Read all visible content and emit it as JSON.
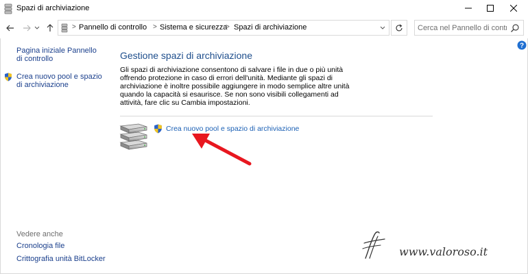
{
  "window": {
    "title": "Spazi di archiviazione"
  },
  "address_bar": {
    "crumbs": [
      "Pannello di controllo",
      "Sistema e sicurezza",
      "Spazi di archiviazione"
    ],
    "separator": ">"
  },
  "search": {
    "placeholder": "Cerca nel Pannello di controllo"
  },
  "left_pane": {
    "home_link": "Pagina iniziale Pannello di controllo",
    "create_link": "Crea nuovo pool e spazio di archiviazione",
    "see_also_header": "Vedere anche",
    "see_also": [
      "Cronologia file",
      "Crittografia unità BitLocker"
    ]
  },
  "main": {
    "title": "Gestione spazi di archiviazione",
    "description": "Gli spazi di archiviazione consentono di salvare i file in due o più unità offrendo protezione in caso di errori dell'unità. Mediante gli spazi di archiviazione è inoltre possibile aggiungere in modo semplice altre unità quando la capacità si esaurisce. Se non sono visibili collegamenti ad attività, fare clic su Cambia impostazioni.",
    "create_link": "Crea nuovo pool e spazio di archiviazione"
  },
  "watermark": {
    "text": "www.valoroso.it"
  },
  "icons": {
    "title_icon": "storage-spaces-icon",
    "back": "back-arrow-icon",
    "forward": "forward-arrow-icon",
    "recent": "chevron-down-icon",
    "up": "up-arrow-icon",
    "refresh": "refresh-icon",
    "search": "search-icon",
    "help": "help-icon",
    "shield": "uac-shield-icon",
    "drives": "storage-drives-icon",
    "annotation": "red-arrow-icon"
  },
  "colors": {
    "link": "#1a3f8c",
    "main_link": "#1a5fb4",
    "title": "#1e4e8c",
    "help_badge": "#1f6fd1",
    "arrow": "#e8171f",
    "border": "#d9d9d9"
  }
}
